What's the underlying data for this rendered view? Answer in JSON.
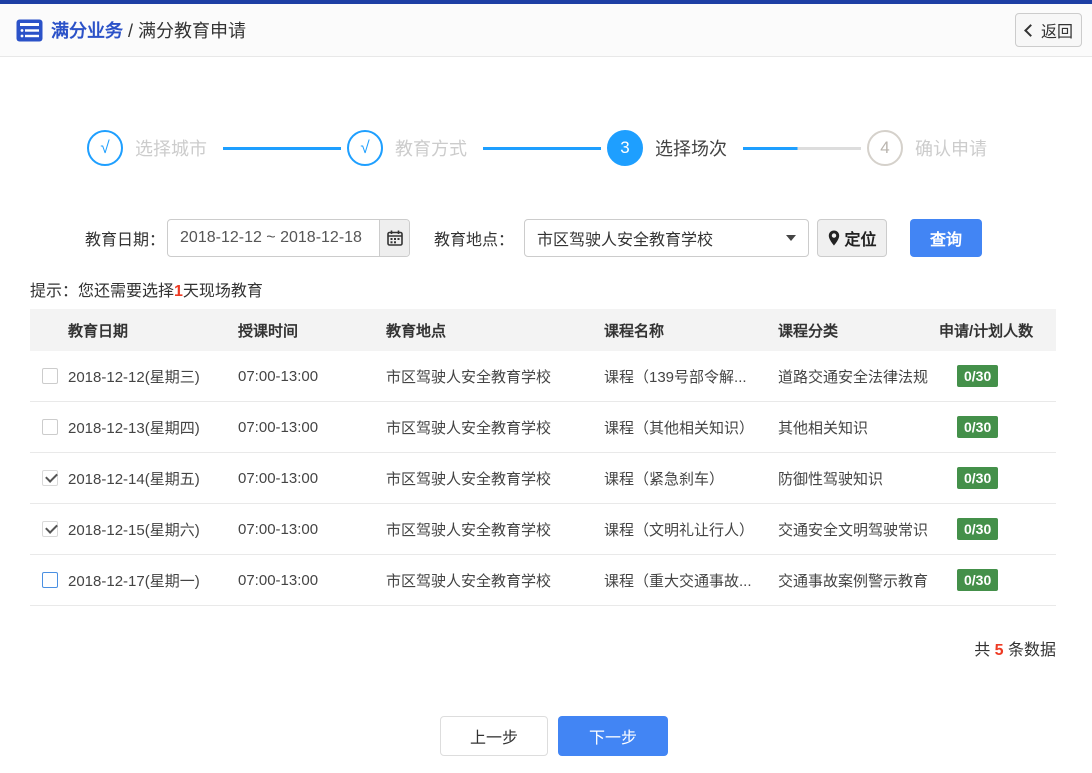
{
  "header": {
    "title_primary": "满分业务",
    "title_rest": " / 满分教育申请",
    "back_label": "返回"
  },
  "steps": [
    {
      "num": "√",
      "label": "选择城市",
      "state": "done"
    },
    {
      "num": "√",
      "label": "教育方式",
      "state": "done"
    },
    {
      "num": "3",
      "label": "选择场次",
      "state": "active"
    },
    {
      "num": "4",
      "label": "确认申请",
      "state": "pending"
    }
  ],
  "filters": {
    "date_label": "教育日期：",
    "date_value": "2018-12-12 ~ 2018-12-18",
    "place_label": "教育地点：",
    "place_value": "市区驾驶人安全教育学校",
    "locate_label": "定位",
    "query_label": "查询"
  },
  "hint": {
    "prefix": "提示：您还需要选择",
    "count": "1",
    "suffix": "天现场教育"
  },
  "table": {
    "columns": [
      "教育日期",
      "授课时间",
      "教育地点",
      "课程名称",
      "课程分类",
      "申请/计划人数"
    ],
    "rows": [
      {
        "checked": false,
        "highlight": false,
        "date": "2018-12-12(星期三)",
        "time": "07:00-13:00",
        "place": "市区驾驶人安全教育学校",
        "course": "课程（139号部令解...",
        "category": "道路交通安全法律法规",
        "count": "0/30"
      },
      {
        "checked": false,
        "highlight": false,
        "date": "2018-12-13(星期四)",
        "time": "07:00-13:00",
        "place": "市区驾驶人安全教育学校",
        "course": "课程（其他相关知识）",
        "category": "其他相关知识",
        "count": "0/30"
      },
      {
        "checked": true,
        "highlight": false,
        "date": "2018-12-14(星期五)",
        "time": "07:00-13:00",
        "place": "市区驾驶人安全教育学校",
        "course": "课程（紧急刹车）",
        "category": "防御性驾驶知识",
        "count": "0/30"
      },
      {
        "checked": true,
        "highlight": false,
        "date": "2018-12-15(星期六)",
        "time": "07:00-13:00",
        "place": "市区驾驶人安全教育学校",
        "course": "课程（文明礼让行人）",
        "category": "交通安全文明驾驶常识",
        "count": "0/30"
      },
      {
        "checked": false,
        "highlight": true,
        "date": "2018-12-17(星期一)",
        "time": "07:00-13:00",
        "place": "市区驾驶人安全教育学校",
        "course": "课程（重大交通事故...",
        "category": "交通事故案例警示教育",
        "count": "0/30"
      }
    ]
  },
  "summary": {
    "prefix": "共 ",
    "count": "5",
    "suffix": " 条数据"
  },
  "footer": {
    "prev_label": "上一步",
    "next_label": "下一步"
  },
  "colors": {
    "accent_blue": "#4285f4",
    "step_blue": "#1e9fff",
    "brand_blue": "#2b52c8",
    "badge_green": "#44904a",
    "alert_red": "#ee3a23",
    "strip_blue": "#1e3fa4"
  }
}
